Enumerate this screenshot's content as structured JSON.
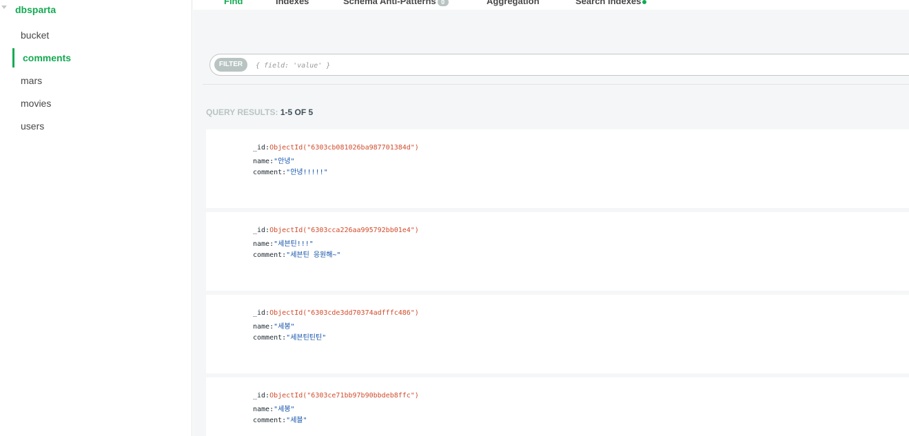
{
  "sidebar": {
    "database": "dbsparta",
    "collections": [
      {
        "label": "bucket",
        "active": false
      },
      {
        "label": "comments",
        "active": true
      },
      {
        "label": "mars",
        "active": false
      },
      {
        "label": "movies",
        "active": false
      },
      {
        "label": "users",
        "active": false
      }
    ]
  },
  "tabs": {
    "find": "Find",
    "indexes": "Indexes",
    "schema": "Schema Anti-Patterns",
    "schema_badge": "0",
    "aggregation": "Aggregation",
    "search": "Search Indexes"
  },
  "filter": {
    "label": "FILTER",
    "placeholder": "{ field: 'value' }"
  },
  "results": {
    "label": "QUERY RESULTS:",
    "range": "1-5 OF 5"
  },
  "documents": [
    {
      "id_key": "_id:",
      "id": "ObjectId(\"6303cb081026ba987701384d\")",
      "name_key": "name:",
      "name": "\"안녕\"",
      "comment_key": "comment:",
      "comment": "\"안녕!!!!!\""
    },
    {
      "id_key": "_id:",
      "id": "ObjectId(\"6303cca226aa995792bb01e4\")",
      "name_key": "name:",
      "name": "\"세븐틴!!!\"",
      "comment_key": "comment:",
      "comment": "\"세븐틴 응원해~\""
    },
    {
      "id_key": "_id:",
      "id": "ObjectId(\"6303cde3dd70374adfffc486\")",
      "name_key": "name:",
      "name": "\"세봉\"",
      "comment_key": "comment:",
      "comment": "\"세븐틴틴틴\""
    },
    {
      "id_key": "_id:",
      "id": "ObjectId(\"6303ce71bb97b90bbdeb8ffc\")",
      "name_key": "name:",
      "name": "\"세봉\"",
      "comment_key": "comment:",
      "comment": "\"세블\""
    }
  ],
  "colors": {
    "accent": "#13aa52",
    "objectid": "#d14a2a",
    "string": "#0d4fa8"
  }
}
